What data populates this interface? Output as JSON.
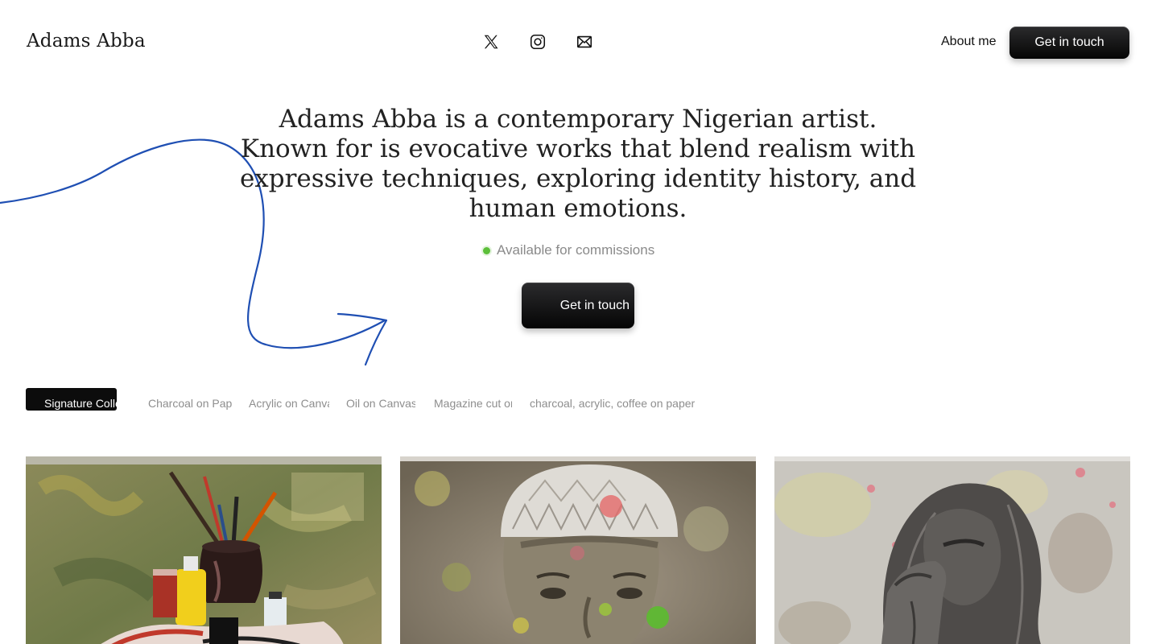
{
  "brand": {
    "name": "Adams Abba"
  },
  "socials": [
    {
      "icon": "x-twitter-icon"
    },
    {
      "icon": "instagram-icon"
    },
    {
      "icon": "mail-icon"
    }
  ],
  "nav": {
    "about_label": "About me",
    "cta_label": "Get in touch"
  },
  "hero": {
    "headline": "Adams Abba is a contemporary Nigerian artist. Known for is evocative works that blend realism with expressive techniques, exploring identity history, and human emotions.",
    "availability": "Available for commissions",
    "cta_label": "Get in touch"
  },
  "tabs": [
    {
      "label": "Signature Collection",
      "active": true
    },
    {
      "label": "Charcoal on Paper",
      "active": false
    },
    {
      "label": "Acrylic on Canvas",
      "active": false
    },
    {
      "label": "Oil on Canvas",
      "active": false
    },
    {
      "label": "Magazine cut on canvas",
      "active": false
    },
    {
      "label": "charcoal, acrylic, coffee on paper",
      "active": false
    }
  ],
  "gallery": [
    {
      "subject": "still life of paint brushes in a jar"
    },
    {
      "subject": "portrait of a man wearing a cap"
    },
    {
      "subject": "charcoal figure with hand to face"
    }
  ],
  "colors": {
    "accent_green": "#5cbf3a",
    "arrow_blue": "#1f4fb3",
    "button_dark": "#0c0c0c"
  }
}
